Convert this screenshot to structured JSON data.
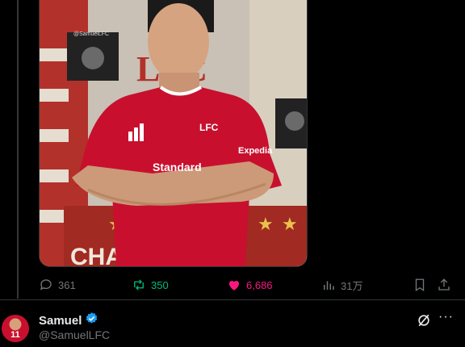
{
  "tweet": {
    "image_text": {
      "account_watermark": "@SamuelLFC",
      "club_letters": "LFC",
      "crest_letters": "LFC",
      "sponsor": "Standard",
      "sleeve_sponsor": "Expedia",
      "banner_text": "CHAMPIONS"
    },
    "actions": {
      "replies": "361",
      "reposts": "350",
      "likes": "6,686",
      "views": "31万"
    }
  },
  "next_author": {
    "name": "Samuel",
    "handle": "@SamuelLFC",
    "avatar_number": "11",
    "verified": true
  },
  "colors": {
    "background": "#000000",
    "muted": "#71767b",
    "repost": "#00ba7c",
    "like": "#f91880",
    "verified": "#1d9bf0",
    "lfc_red": "#c8102e"
  }
}
